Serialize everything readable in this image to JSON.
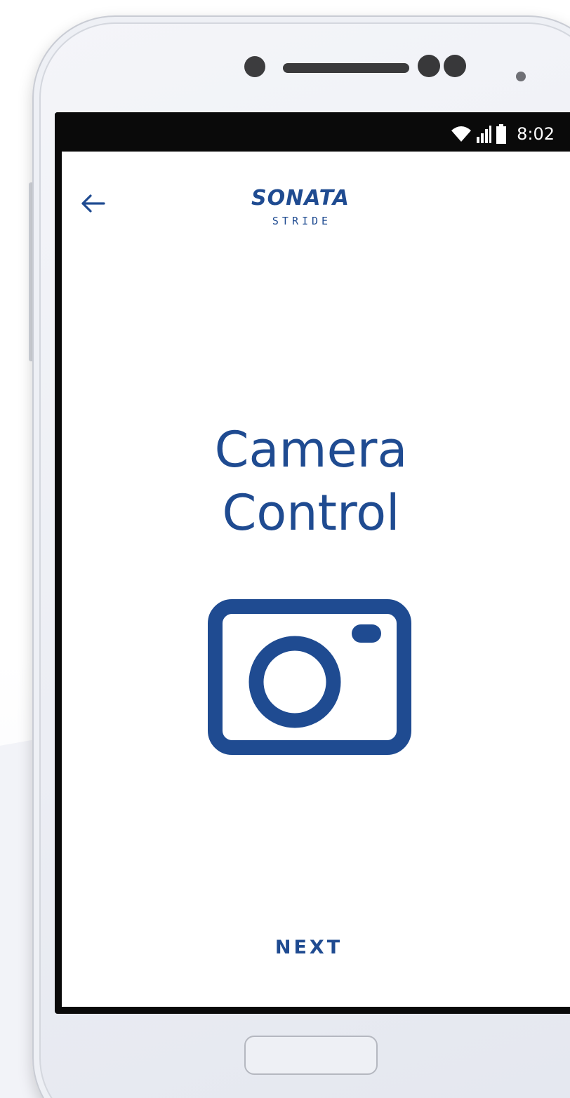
{
  "status_bar": {
    "time": "8:02",
    "icons": [
      "wifi-icon",
      "signal-icon",
      "battery-icon"
    ]
  },
  "header": {
    "back_icon": "arrow-left-icon",
    "logo_primary": "SONATA",
    "logo_secondary": "STRIDE"
  },
  "main": {
    "title_line1": "Camera",
    "title_line2": "Control",
    "icon": "camera-icon"
  },
  "footer": {
    "next_label": "NEXT"
  },
  "colors": {
    "brand_blue": "#1f4b91",
    "status_bar": "#0a0a0a",
    "screen_bg": "#ffffff"
  }
}
